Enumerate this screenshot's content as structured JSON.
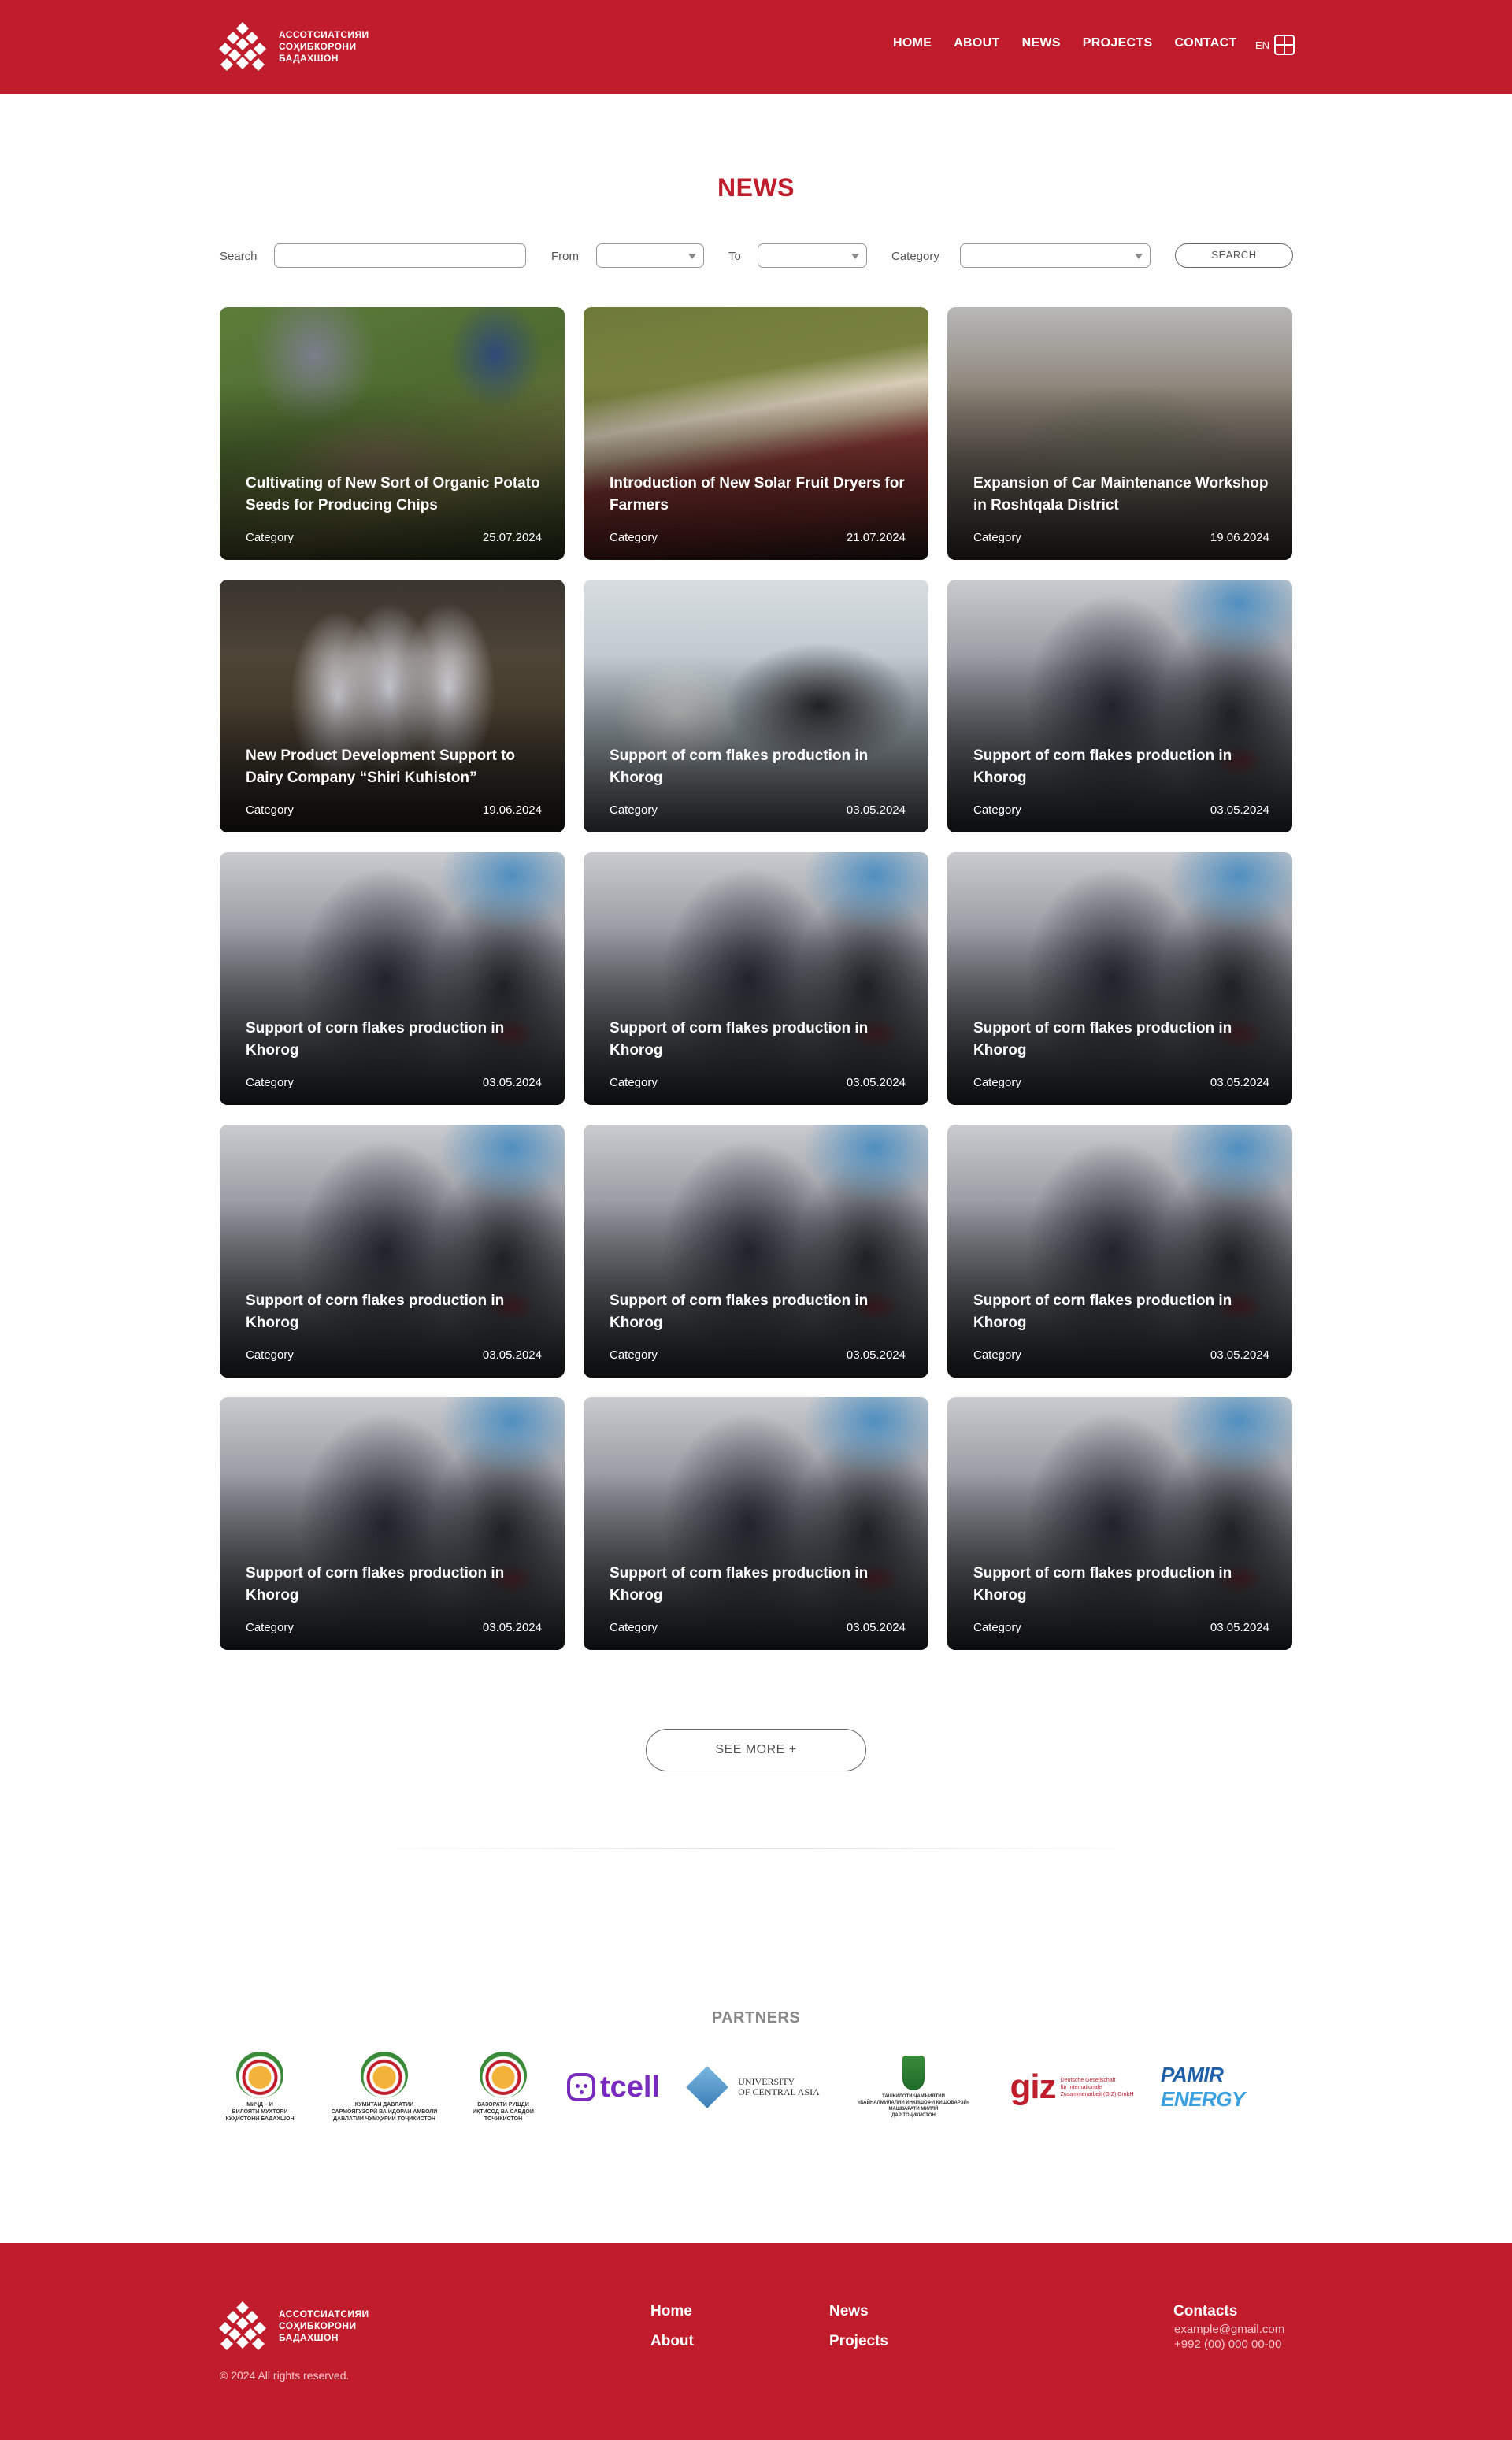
{
  "header": {
    "logo_text": [
      "АССОТСИАТСИЯИ",
      "СОҲИБКОРОНИ",
      "БАДАХШОН"
    ],
    "nav": [
      "HOME",
      "ABOUT",
      "NEWS",
      "PROJECTS",
      "CONTACT"
    ],
    "lang": "EN"
  },
  "page_title": "NEWS",
  "filters": {
    "search_label": "Search",
    "search_value": "",
    "from_label": "From",
    "from_value": "",
    "to_label": "To",
    "to_value": "",
    "category_label": "Category",
    "category_value": "",
    "search_button": "SEARCH"
  },
  "news": [
    {
      "title": "Cultivating of New Sort of Organic Potato Seeds for Producing Chips",
      "category": "Category",
      "date": "25.07.2024",
      "image": "img-potato"
    },
    {
      "title": "Introduction of New Solar Fruit Dryers for Farmers",
      "category": "Category",
      "date": "21.07.2024",
      "image": "img-dryer"
    },
    {
      "title": "Expansion of Car Maintenance Workshop in Roshtqala District",
      "category": "Category",
      "date": "19.06.2024",
      "image": "img-car"
    },
    {
      "title": "New Product Development Support to Dairy Company “Shiri Kuhiston”",
      "category": "Category",
      "date": "19.06.2024",
      "image": "img-milk"
    },
    {
      "title": "Support of corn flakes production in Khorog",
      "category": "Category",
      "date": "03.05.2024",
      "image": "img-lab"
    },
    {
      "title": "Support of corn flakes production in Khorog",
      "category": "Category",
      "date": "03.05.2024",
      "image": "img-blur"
    },
    {
      "title": "Support of corn flakes production in Khorog",
      "category": "Category",
      "date": "03.05.2024",
      "image": "img-blur"
    },
    {
      "title": "Support of corn flakes production in Khorog",
      "category": "Category",
      "date": "03.05.2024",
      "image": "img-blur"
    },
    {
      "title": "Support of corn flakes production in Khorog",
      "category": "Category",
      "date": "03.05.2024",
      "image": "img-blur"
    },
    {
      "title": "Support of corn flakes production in Khorog",
      "category": "Category",
      "date": "03.05.2024",
      "image": "img-blur"
    },
    {
      "title": "Support of corn flakes production in Khorog",
      "category": "Category",
      "date": "03.05.2024",
      "image": "img-blur"
    },
    {
      "title": "Support of corn flakes production in Khorog",
      "category": "Category",
      "date": "03.05.2024",
      "image": "img-blur"
    },
    {
      "title": "Support of corn flakes production in Khorog",
      "category": "Category",
      "date": "03.05.2024",
      "image": "img-blur"
    },
    {
      "title": "Support of corn flakes production in Khorog",
      "category": "Category",
      "date": "03.05.2024",
      "image": "img-blur"
    },
    {
      "title": "Support of corn flakes production in Khorog",
      "category": "Category",
      "date": "03.05.2024",
      "image": "img-blur"
    }
  ],
  "see_more": "SEE MORE +",
  "partners": {
    "title": "PARTNERS",
    "items": [
      {
        "kind": "emblem",
        "caption": "МИҶД – И\nВИЛОЯТИ МУХТОРИ\nКӮҲИСТОНИ БАДАХШОН"
      },
      {
        "kind": "emblem",
        "caption": "КУМИТАИ ДАВЛАТИИ\nСАРМОЯГУЗОРӢ ВА ИДОРАИ АМВОЛИ\nДАВЛАТИИ ҶУМҲУРИИ ТОҶИКИСТОН"
      },
      {
        "kind": "emblem",
        "caption": "ВАЗОРАТИ РУШДИ\nИҚТИСОД ВА САВДОИ\nТОҶИКИСТОН"
      },
      {
        "kind": "tcell",
        "caption": "tcell"
      },
      {
        "kind": "uca",
        "caption": "UNIVERSITY\nOF CENTRAL ASIA"
      },
      {
        "kind": "stamp",
        "caption": "ТАШКИЛОТИ ҶАМЪИЯТИИ\n«БАЙНАЛМИЛАЛИИ ИНКИШОФИ КИШОВАРЗӢ»\nМАШВАРАТИ МИЛЛӢ\nДАР ТОҶИКИСТОН"
      },
      {
        "kind": "giz",
        "caption": "Deutsche Gesellschaft\nfür Internationale\nZusammenarbeit (GIZ) GmbH"
      },
      {
        "kind": "pamir",
        "caption": "PAMIR ENERGY"
      }
    ]
  },
  "footer": {
    "logo_text": [
      "АССОТСИАТСИЯИ",
      "СОҲИБКОРОНИ",
      "БАДАХШОН"
    ],
    "links": [
      "Home",
      "About",
      "News",
      "Projects"
    ],
    "contacts_title": "Contacts",
    "email": "example@gmail.com",
    "phone": "+992 (00) 000 00-00",
    "copyright": "© 2024 All rights reserved."
  },
  "colors": {
    "brand": "#c11c2c",
    "text_muted": "#888888"
  }
}
